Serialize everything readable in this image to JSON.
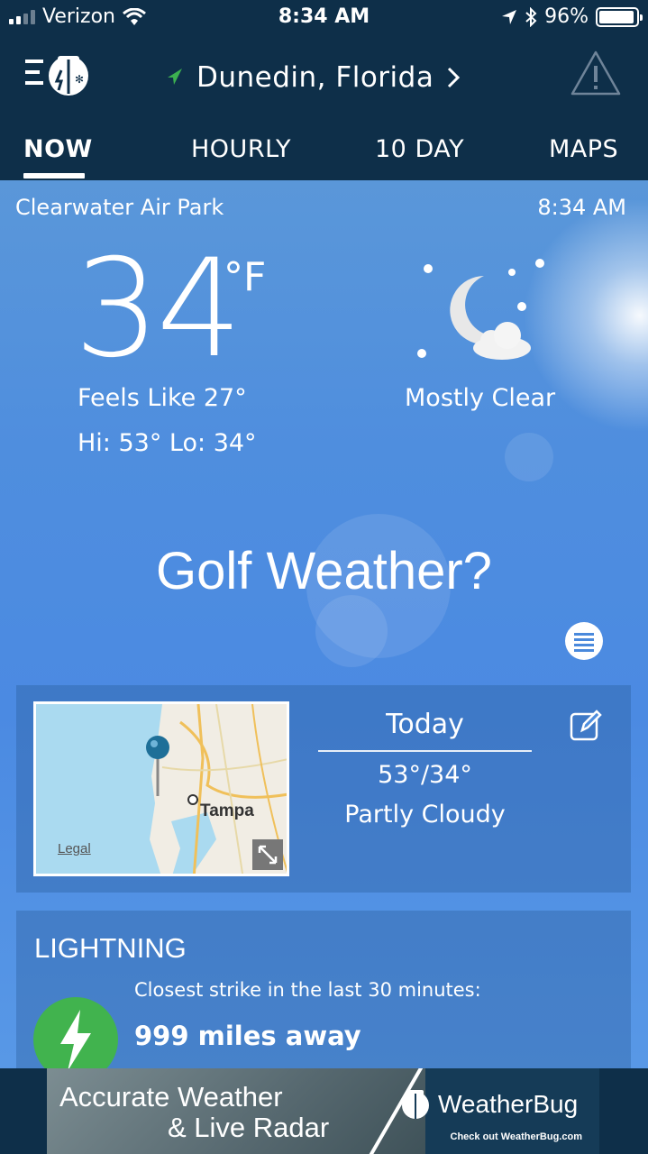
{
  "status_bar": {
    "carrier": "Verizon",
    "time": "8:34 AM",
    "battery": "96%",
    "battery_level": 0.96
  },
  "header": {
    "location": "Dunedin, Florida",
    "tabs": [
      {
        "label": "NOW",
        "active": true
      },
      {
        "label": "HOURLY",
        "active": false
      },
      {
        "label": "10 DAY",
        "active": false
      },
      {
        "label": "MAPS",
        "active": false
      }
    ]
  },
  "current": {
    "station": "Clearwater Air Park",
    "observed_time": "8:34 AM",
    "temperature": "34",
    "unit": "°F",
    "feels_like": "Feels Like 27°",
    "hi_lo": "Hi: 53° Lo: 34°",
    "condition": "Mostly Clear",
    "condition_icon": "moon-cloud-icon"
  },
  "promo": {
    "text": "Golf Weather?"
  },
  "forecast_card": {
    "day": "Today",
    "hi_lo": "53°/34°",
    "condition": "Partly Cloudy",
    "map": {
      "city_label": "Tampa",
      "legal_label": "Legal"
    }
  },
  "lightning_card": {
    "title": "LIGHTNING",
    "subtitle": "Closest strike in the last 30 minutes:",
    "distance": "999 miles away"
  },
  "ad": {
    "line1": "Accurate Weather",
    "line2": "& Live Radar",
    "brand": "WeatherBug",
    "sub": "Check out WeatherBug.com"
  },
  "colors": {
    "header_bg": "#0e2f49",
    "sky_blue": "#4f8ede",
    "lightning_green": "#41b34e",
    "nav_arrow_green": "#3cb050"
  }
}
